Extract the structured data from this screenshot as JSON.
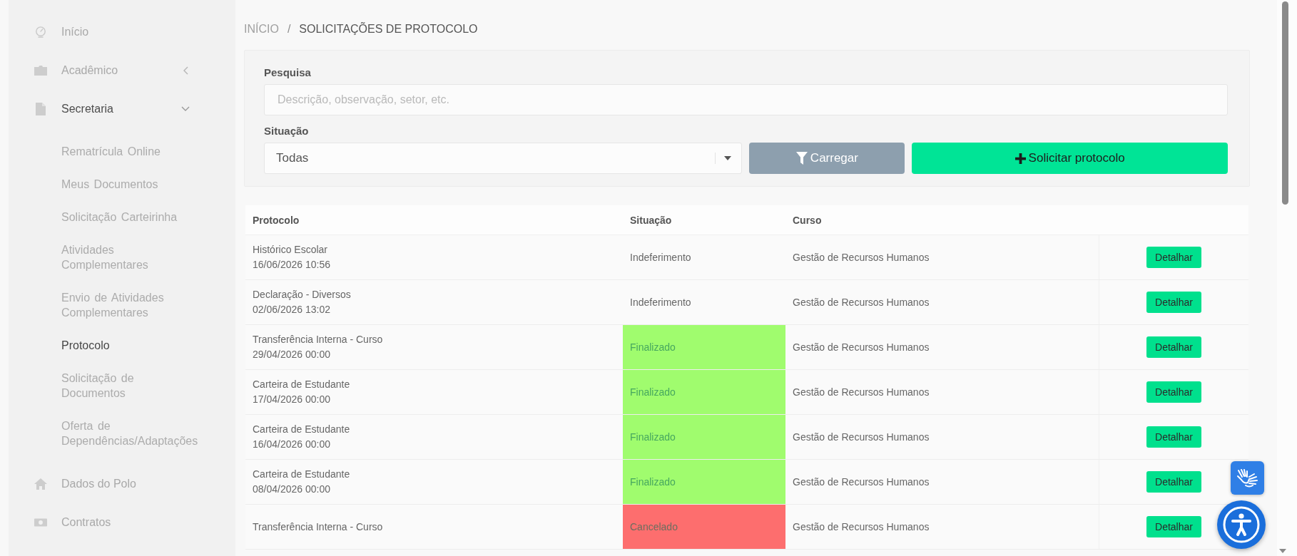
{
  "sidebar": {
    "items": [
      {
        "kind": "link",
        "label": "Início"
      },
      {
        "kind": "group",
        "label": "Acadêmico",
        "expanded": false
      },
      {
        "kind": "group",
        "label": "Secretaria",
        "expanded": true,
        "children": [
          {
            "label": "Rematrícula Online",
            "selected": false
          },
          {
            "label": "Meus Documentos",
            "selected": false
          },
          {
            "label": "Solicitação Carteirinha",
            "selected": false
          },
          {
            "label": "Atividades Complementares",
            "selected": false
          },
          {
            "label": "Envio de Atividades Complementares",
            "selected": false
          },
          {
            "label": "Protocolo",
            "selected": true
          },
          {
            "label": "Solicitação de Documentos",
            "selected": false
          },
          {
            "label": "Oferta de Dependências/Adaptações",
            "selected": false
          }
        ]
      },
      {
        "kind": "link",
        "label": "Dados do Polo"
      },
      {
        "kind": "link",
        "label": "Contratos"
      }
    ]
  },
  "breadcrumb": {
    "separator": "/",
    "items": [
      {
        "label": "INÍCIO",
        "current": false
      },
      {
        "label": "SOLICITAÇÕES DE PROTOCOLO",
        "current": true
      }
    ]
  },
  "filters": {
    "search": {
      "label": "Pesquisa",
      "placeholder": "Descrição, observação, setor, etc."
    },
    "status": {
      "label": "Situação",
      "value": "Todas"
    },
    "load_button": "Carregar",
    "request_button": "Solicitar protocolo"
  },
  "table": {
    "columns": [
      "Protocolo",
      "Situação",
      "Curso"
    ],
    "rows": [
      {
        "title": "Histórico Escolar",
        "date": "16/06/2026 10:56",
        "status": {
          "text": "Indeferimento"
        },
        "course": "Gestão de Recursos Humanos",
        "action": "Detalhar"
      },
      {
        "title": "Declaração - Diversos",
        "date": "02/06/2026 13:02",
        "status": {
          "text": "Indeferimento"
        },
        "course": "Gestão de Recursos Humanos",
        "action": "Detalhar"
      },
      {
        "title": "Transferência Interna - Curso",
        "date": "29/04/2026 00:00",
        "status": {
          "text": "Finalizado",
          "color": "#a0fc6e"
        },
        "course": "Gestão de Recursos Humanos",
        "action": "Detalhar"
      },
      {
        "title": "Carteira de Estudante",
        "date": "17/04/2026 00:00",
        "status": {
          "text": "Finalizado",
          "color": "#a0fc6e"
        },
        "course": "Gestão de Recursos Humanos",
        "action": "Detalhar"
      },
      {
        "title": "Carteira de Estudante",
        "date": "16/04/2026 00:00",
        "status": {
          "text": "Finalizado",
          "color": "#a0fc6e"
        },
        "course": "Gestão de Recursos Humanos",
        "action": "Detalhar"
      },
      {
        "title": "Carteira de Estudante",
        "date": "08/04/2026 00:00",
        "status": {
          "text": "Finalizado",
          "color": "#a0fc6e"
        },
        "course": "Gestão de Recursos Humanos",
        "action": "Detalhar"
      },
      {
        "title": "Transferência Interna - Curso",
        "status": {
          "text": "Cancelado",
          "color": "#fd6e6e"
        },
        "course": "Gestão de Recursos Humanos",
        "action": "Detalhar"
      }
    ]
  }
}
